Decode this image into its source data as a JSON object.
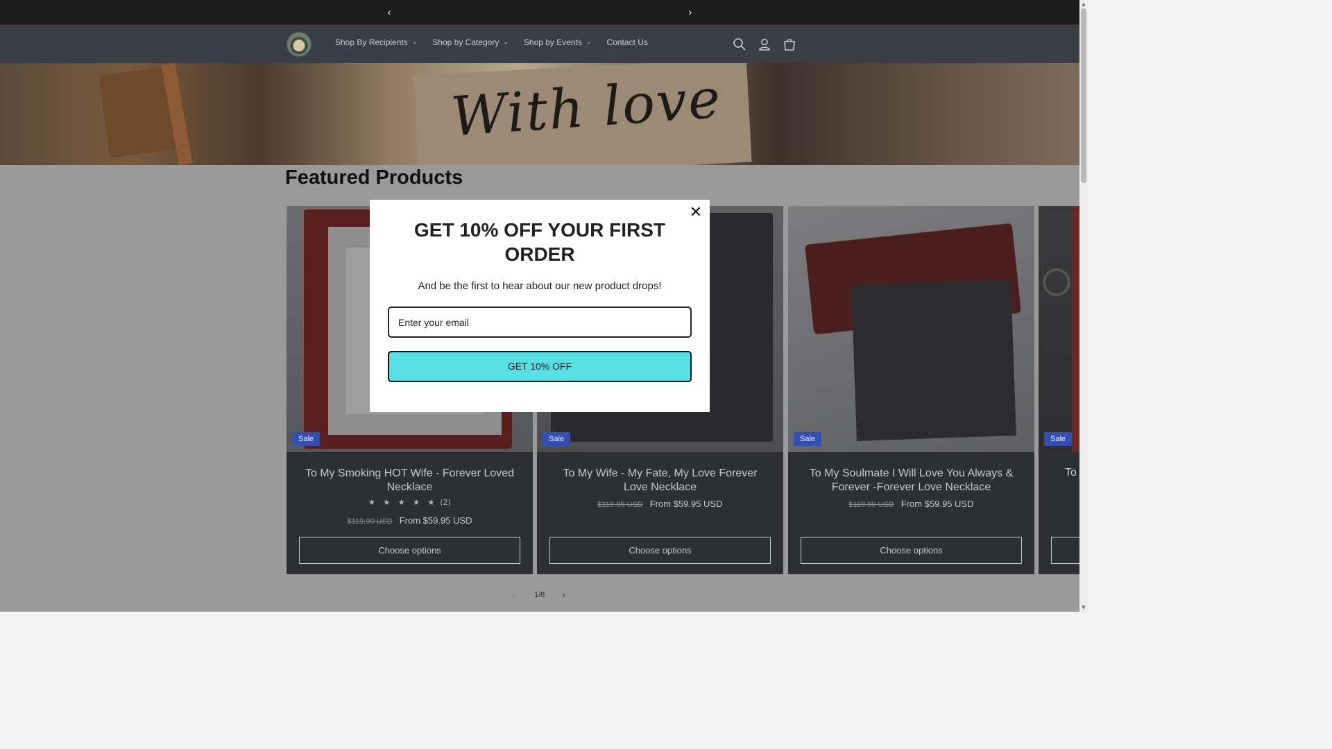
{
  "announcement": {
    "prev_arrow": "‹",
    "next_arrow": "›"
  },
  "header": {
    "nav": [
      {
        "label": "Shop By Recipients",
        "has_dropdown": true
      },
      {
        "label": "Shop by Category",
        "has_dropdown": true
      },
      {
        "label": "Shop by Events",
        "has_dropdown": true
      },
      {
        "label": "Contact Us",
        "has_dropdown": false
      }
    ],
    "icons": [
      "search-icon",
      "account-icon",
      "cart-icon"
    ]
  },
  "hero": {
    "script_text": "With love"
  },
  "section": {
    "title": "Featured Products"
  },
  "products": [
    {
      "badge": "Sale",
      "title": "To My Smoking HOT Wife - Forever Loved Necklace",
      "rating_stars": "★ ★ ★ ★ ★",
      "rating_count": "(2)",
      "compare_price": "$119.90 USD",
      "price": "From $59.95 USD",
      "button": "Choose options"
    },
    {
      "badge": "Sale",
      "title": "To My Wife - My Fate, My Love Forever Love Necklace",
      "compare_price": "$119.95 USD",
      "price": "From $59.95 USD",
      "button": "Choose options"
    },
    {
      "badge": "Sale",
      "title": "To My Soulmate I Will Love You Always & Forever -Forever Love Necklace",
      "compare_price": "$119.90 USD",
      "price": "From $59.95 USD",
      "button": "Choose options"
    },
    {
      "badge": "Sale",
      "title": "To"
    }
  ],
  "pager": {
    "text": "1/8",
    "prev": "‹",
    "next": "›"
  },
  "modal": {
    "title": "GET 10% OFF YOUR FIRST ORDER",
    "subtitle": "And be the first to hear about our new product drops!",
    "email_placeholder": "Enter your email",
    "button": "GET 10% OFF",
    "close": "✕",
    "button_color": "#57dfe3"
  }
}
